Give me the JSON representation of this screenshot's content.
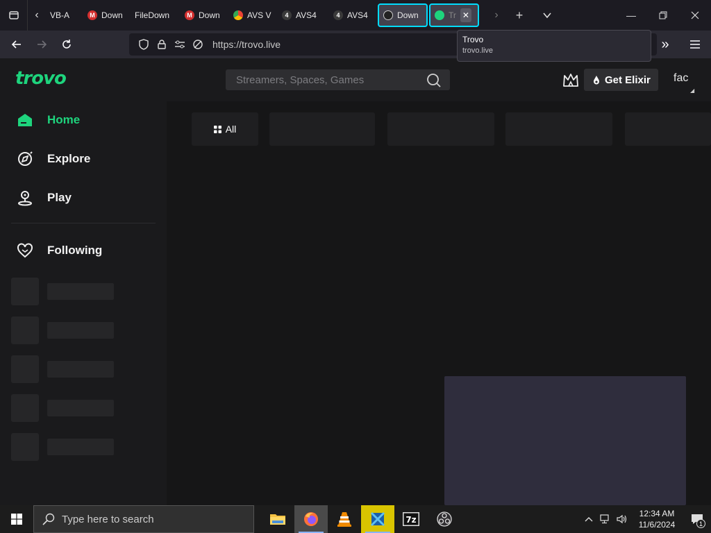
{
  "browser": {
    "tabs": [
      {
        "label": "VB-A",
        "fav_color": "",
        "fav_text": ""
      },
      {
        "label": "Down",
        "fav_color": "#d32f2f",
        "fav_text": "M"
      },
      {
        "label": "FileDown",
        "fav_color": "",
        "fav_text": ""
      },
      {
        "label": "Down",
        "fav_color": "#d32f2f",
        "fav_text": "M"
      },
      {
        "label": "AVS V",
        "fav_color": "#4285f4",
        "fav_text": ""
      },
      {
        "label": "AVS4",
        "fav_color": "#3a3a3a",
        "fav_text": "4"
      },
      {
        "label": "AVS4",
        "fav_color": "#3a3a3a",
        "fav_text": "4"
      },
      {
        "label": "Down",
        "fav_color": "#555",
        "fav_text": ""
      },
      {
        "label": "Tr",
        "fav_color": "#1ed47d",
        "fav_text": ""
      }
    ],
    "tab_close_glyph": "✕",
    "url": "https://trovo.live",
    "tooltip": {
      "title": "Trovo",
      "url": "trovo.live"
    }
  },
  "trovo": {
    "logo_text": "trovo",
    "search_placeholder": "Streamers, Spaces, Games",
    "elixir_label": "Get Elixir",
    "user_label": "fac",
    "nav": [
      {
        "label": "Home"
      },
      {
        "label": "Explore"
      },
      {
        "label": "Play"
      }
    ],
    "following_label": "Following",
    "category_all": "All",
    "accent_color": "#1ed47d"
  },
  "taskbar": {
    "search_placeholder": "Type here to search",
    "time": "12:34 AM",
    "date": "11/6/2024",
    "notif_count": "1"
  }
}
